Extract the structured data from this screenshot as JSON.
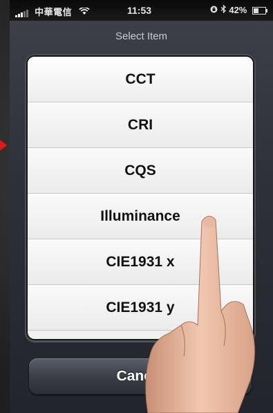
{
  "status_bar": {
    "carrier": "中華電信",
    "time": "11:53",
    "battery": "42%",
    "battery_level": 0.42
  },
  "sheet": {
    "title": "Select Item",
    "items": [
      "CCT",
      "CRI",
      "CQS",
      "Illuminance",
      "CIE1931 x",
      "CIE1931 y"
    ],
    "cancel_label": "Cancel"
  },
  "icons": {
    "signal": "signal-bars-icon",
    "wifi": "wifi-icon",
    "lock": "rotation-lock-icon",
    "bluetooth": "bluetooth-icon",
    "battery": "battery-icon"
  },
  "colors": {
    "marker": "#e01818",
    "sheet_bg": "#2d3139",
    "picker_bg": "#f0f0f0"
  }
}
